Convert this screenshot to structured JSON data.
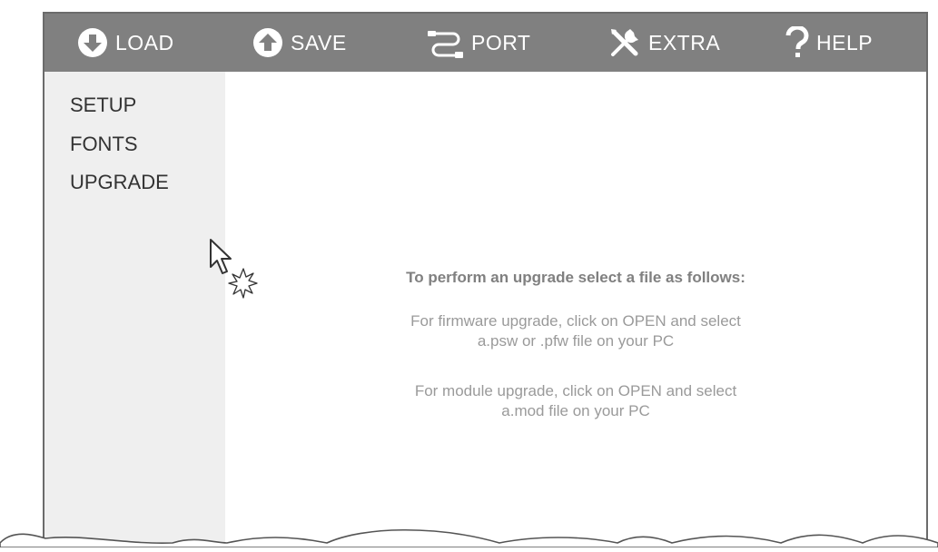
{
  "toolbar": {
    "load_label": "LOAD",
    "save_label": "SAVE",
    "port_label": "PORT",
    "extra_label": "EXTRA",
    "help_label": "HELP",
    "background": "#808080"
  },
  "sidebar": {
    "items": [
      {
        "label": "SETUP"
      },
      {
        "label": "FONTS"
      },
      {
        "label": "UPGRADE"
      }
    ]
  },
  "content": {
    "title": "To perform an upgrade select a file as follows:",
    "firmware_line1": "For firmware upgrade, click on OPEN and select",
    "firmware_line2": "a.psw or .pfw file on your PC",
    "module_line1": "For module upgrade, click on OPEN and select",
    "module_line2": "a.mod file on your PC"
  },
  "icons": {
    "load": "download-arrow-circle-icon",
    "save": "upload-arrow-circle-icon",
    "port": "cable-icon",
    "extra": "tools-icon",
    "help": "question-mark-icon",
    "cursor": "pointer-cursor-click-icon"
  }
}
